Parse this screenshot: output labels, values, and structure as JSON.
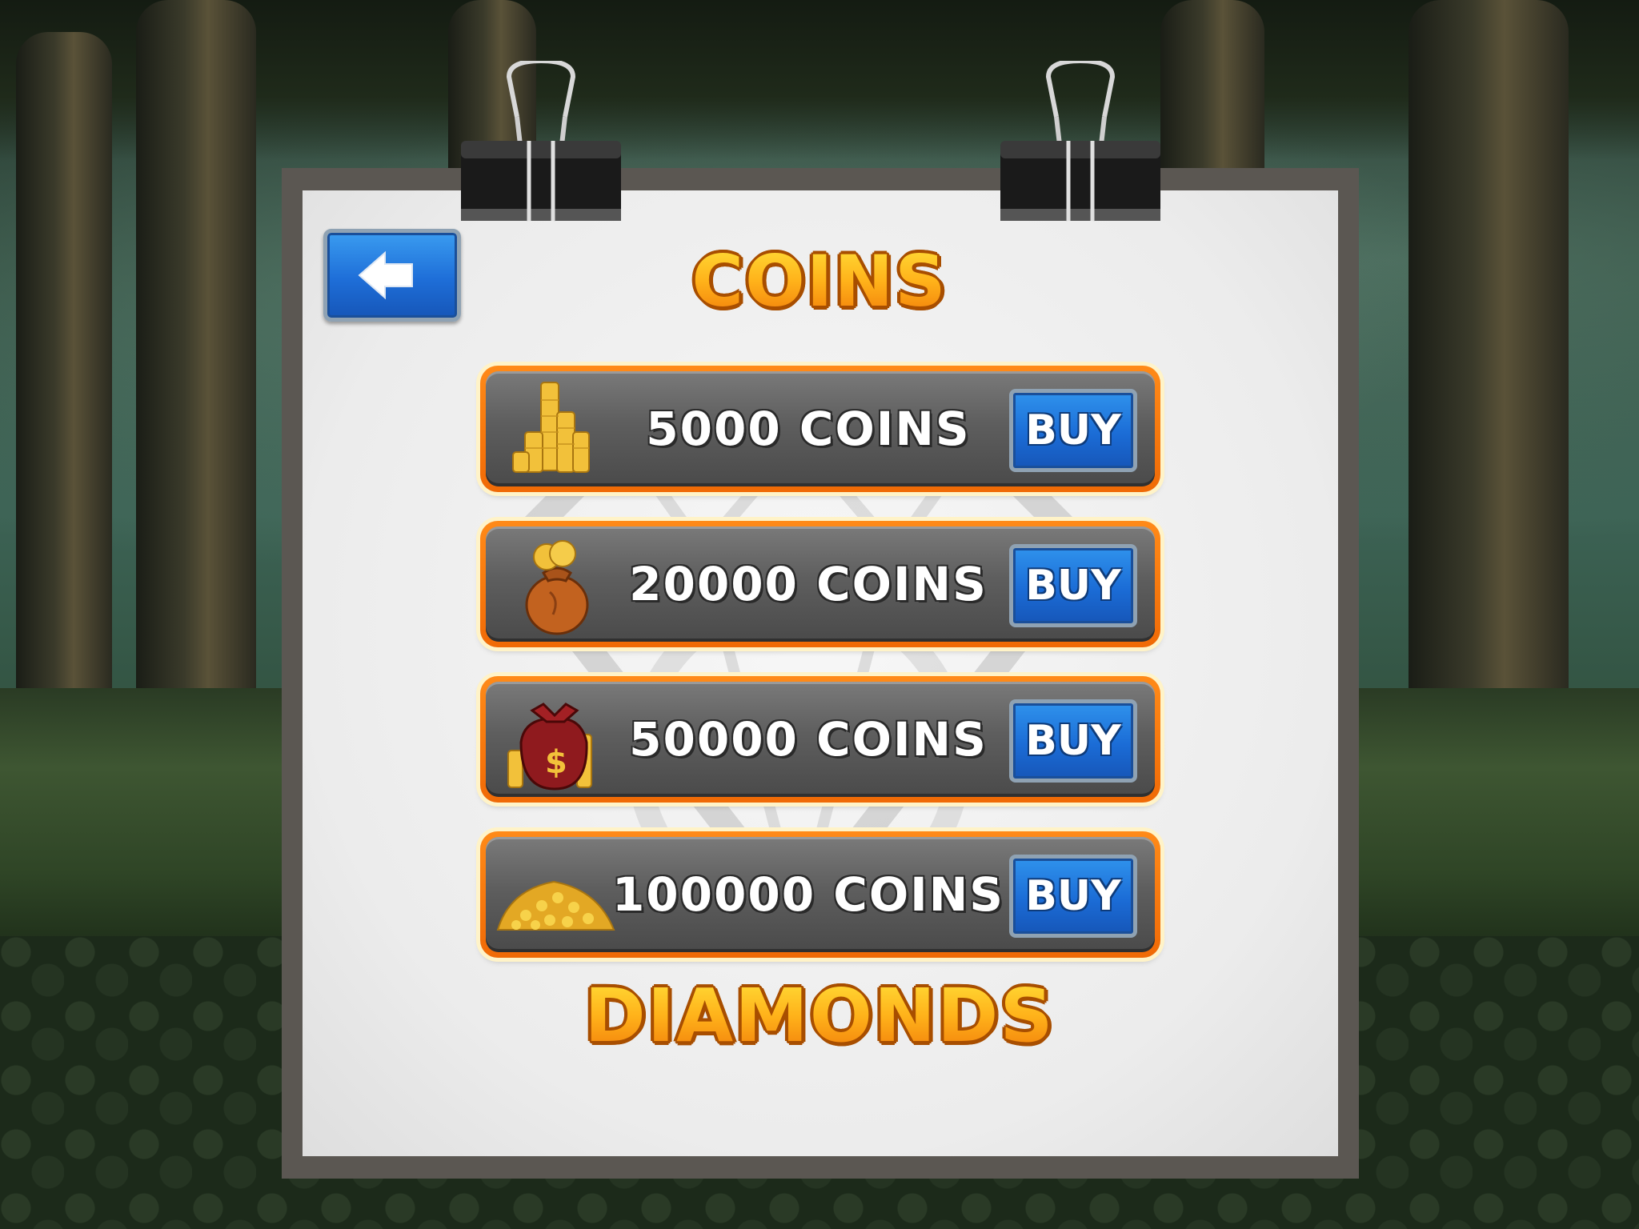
{
  "header": {
    "back_button_label": "",
    "title": "COINS"
  },
  "offers": [
    {
      "label": "5000 COINS",
      "buy_label": "BUY",
      "icon": "coin-stacks-icon"
    },
    {
      "label": "20000 COINS",
      "buy_label": "BUY",
      "icon": "coin-sack-icon"
    },
    {
      "label": "50000 COINS",
      "buy_label": "BUY",
      "icon": "money-bag-icon"
    },
    {
      "label": "100000 COINS",
      "buy_label": "BUY",
      "icon": "coin-pile-icon"
    }
  ],
  "diamonds_section": {
    "title": "DIAMONDS"
  },
  "colors": {
    "title_gold": "#ffb414",
    "row_border_orange": "#f06a06",
    "button_blue": "#1b6cd6",
    "board_frame": "#5b5752"
  }
}
